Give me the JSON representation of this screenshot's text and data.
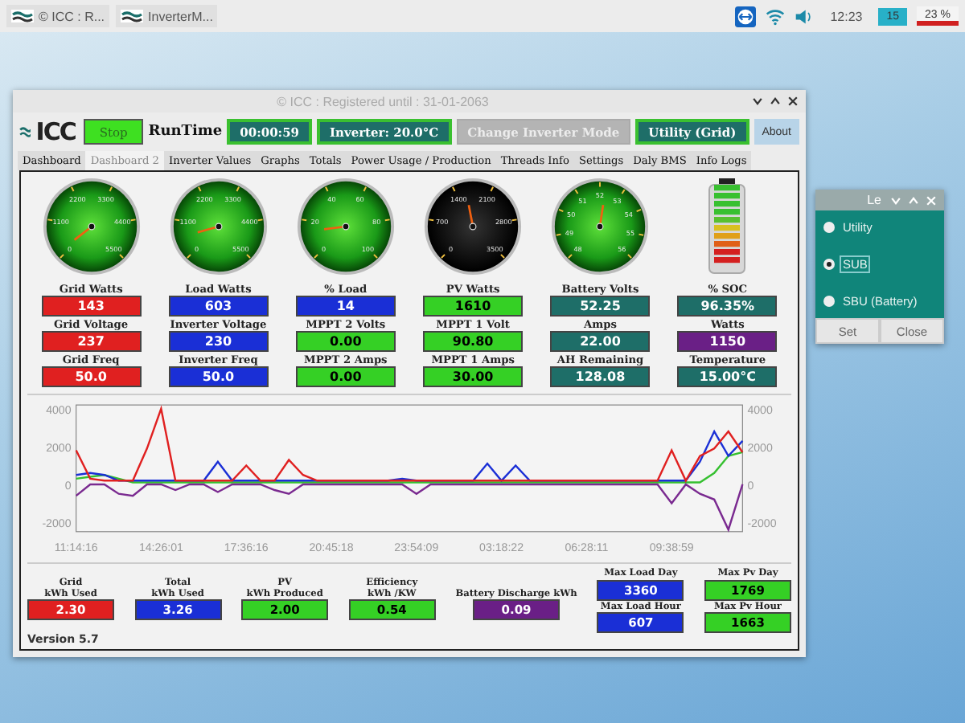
{
  "taskbar": {
    "tasks": [
      {
        "label": "© ICC : R..."
      },
      {
        "label": "InverterM..."
      }
    ],
    "clock": "12:23",
    "cpu_widgets": [
      "15",
      "23 %"
    ]
  },
  "window": {
    "title": "© ICC : Registered until : 31-01-2063",
    "logo": "ICC",
    "toolbar": {
      "stop_button": "Stop",
      "runtime_label": "RunTime",
      "runtime": "00:00:59",
      "inverter_temp": "Inverter: 20.0°C",
      "mode_button": {
        "label": "Change Inverter Mode",
        "disabled": true
      },
      "mode_status": "Utility (Grid)",
      "about_button": "About"
    },
    "tabs": [
      {
        "label": "Dashboard",
        "selected": false
      },
      {
        "label": "Dashboard 2",
        "selected": true
      },
      {
        "label": "Inverter Values",
        "selected": false
      },
      {
        "label": "Graphs",
        "selected": false
      },
      {
        "label": "Totals",
        "selected": false
      },
      {
        "label": "Power Usage / Production",
        "selected": false
      },
      {
        "label": "Threads Info",
        "selected": false
      },
      {
        "label": "Settings",
        "selected": false
      },
      {
        "label": "Daly BMS",
        "selected": false
      },
      {
        "label": "Info Logs",
        "selected": false
      }
    ],
    "columns": [
      {
        "kind": "gauge",
        "gauge": {
          "kind": "green",
          "ticks": [
            "0",
            "1100",
            "2200",
            "3300",
            "4400",
            "5500"
          ]
        },
        "readings": [
          {
            "label": "Grid Watts",
            "value": "143",
            "color": "#e02020"
          },
          {
            "label": "Grid Voltage",
            "value": "237",
            "color": "#e02020"
          },
          {
            "label": "Grid Freq",
            "value": "50.0",
            "color": "#e02020"
          }
        ]
      },
      {
        "kind": "gauge",
        "gauge": {
          "kind": "green",
          "ticks": [
            "0",
            "1100",
            "2200",
            "3300",
            "4400",
            "5500"
          ]
        },
        "readings": [
          {
            "label": "Load Watts",
            "value": "603",
            "color": "#1a2fd6"
          },
          {
            "label": "Inverter Voltage",
            "value": "230",
            "color": "#1a2fd6"
          },
          {
            "label": "Inverter Freq",
            "value": "50.0",
            "color": "#1a2fd6"
          }
        ]
      },
      {
        "kind": "gauge",
        "gauge": {
          "kind": "green",
          "ticks": [
            "0",
            "20",
            "40",
            "60",
            "80",
            "100"
          ]
        },
        "readings": [
          {
            "label": "% Load",
            "value": "14",
            "color": "#1a2fd6"
          },
          {
            "label": "MPPT 2 Volts",
            "value": "0.00",
            "color": "#35d025"
          },
          {
            "label": "MPPT 2 Amps",
            "value": "0.00",
            "color": "#35d025"
          }
        ]
      },
      {
        "kind": "gauge",
        "gauge": {
          "kind": "dark",
          "ticks": [
            "0",
            "700",
            "1400",
            "2100",
            "2800",
            "3500"
          ]
        },
        "readings": [
          {
            "label": "PV Watts",
            "value": "1610",
            "color": "#35d025"
          },
          {
            "label": "MPPT 1 Volt",
            "value": "90.80",
            "color": "#35d025"
          },
          {
            "label": "MPPT 1 Amps",
            "value": "30.00",
            "color": "#35d025"
          }
        ]
      },
      {
        "kind": "gauge",
        "gauge": {
          "kind": "green",
          "ticks": [
            "48",
            "49",
            "50",
            "51",
            "52",
            "53",
            "54",
            "55",
            "56"
          ]
        },
        "readings": [
          {
            "label": "Battery Volts",
            "value": "52.25",
            "color": "#1e6e68"
          },
          {
            "label": "Amps",
            "value": "22.00",
            "color": "#1e6e68"
          },
          {
            "label": "AH Remaining",
            "value": "128.08",
            "color": "#1e6e68"
          }
        ]
      },
      {
        "kind": "battery",
        "battery": {
          "level": 0.96
        },
        "readings": [
          {
            "label": "% SOC",
            "value": "96.35%",
            "color": "#1e6e68"
          },
          {
            "label": "Watts",
            "value": "1150",
            "color": "#6a1f86"
          },
          {
            "label": "Temperature",
            "value": "15.00°C",
            "color": "#1e6e68"
          }
        ]
      }
    ],
    "chart_data": {
      "type": "line",
      "categories": [
        "11:14:16",
        null,
        null,
        null,
        null,
        null,
        "14:26:01",
        null,
        null,
        null,
        null,
        null,
        "17:36:16",
        null,
        null,
        null,
        null,
        null,
        "20:45:18",
        null,
        null,
        null,
        null,
        null,
        "23:54:09",
        null,
        null,
        null,
        null,
        null,
        "03:18:22",
        null,
        null,
        null,
        null,
        null,
        "06:28:11",
        null,
        null,
        null,
        null,
        null,
        "09:38:59",
        null,
        null,
        null,
        null,
        null
      ],
      "ylim": [
        -2500,
        4200
      ],
      "yticks": [
        -2000,
        0,
        2000,
        4000
      ],
      "y2ticks": [
        -2000,
        0,
        2000,
        4000
      ],
      "y2lim": [
        -2500,
        4200
      ],
      "series": [
        {
          "color": "#35c030",
          "values": [
            300,
            400,
            500,
            300,
            100,
            100,
            100,
            100,
            100,
            100,
            100,
            100,
            100,
            100,
            100,
            100,
            100,
            100,
            100,
            100,
            100,
            100,
            100,
            100,
            100,
            100,
            100,
            100,
            100,
            100,
            100,
            100,
            100,
            100,
            100,
            100,
            100,
            100,
            100,
            100,
            100,
            100,
            100,
            100,
            100,
            600,
            1500,
            1700
          ]
        },
        {
          "color": "#1a2fd6",
          "values": [
            500,
            600,
            500,
            200,
            200,
            200,
            200,
            200,
            200,
            200,
            1200,
            200,
            200,
            200,
            200,
            200,
            200,
            200,
            200,
            200,
            200,
            200,
            200,
            300,
            200,
            200,
            200,
            200,
            200,
            1100,
            200,
            1000,
            200,
            200,
            200,
            200,
            200,
            200,
            200,
            200,
            200,
            200,
            200,
            200,
            1200,
            2800,
            1500,
            2300
          ]
        },
        {
          "color": "#7a2a90",
          "values": [
            -600,
            0,
            0,
            -500,
            -600,
            0,
            0,
            -300,
            0,
            0,
            -400,
            0,
            0,
            0,
            -300,
            -500,
            0,
            0,
            0,
            0,
            0,
            0,
            0,
            0,
            -500,
            0,
            0,
            0,
            0,
            0,
            0,
            0,
            0,
            0,
            0,
            0,
            0,
            0,
            0,
            0,
            0,
            0,
            -1000,
            0,
            -500,
            -800,
            -2400,
            0
          ]
        },
        {
          "color": "#e02020",
          "values": [
            1800,
            300,
            200,
            200,
            200,
            1900,
            4000,
            200,
            200,
            200,
            200,
            200,
            1000,
            200,
            200,
            1300,
            500,
            200,
            200,
            200,
            200,
            200,
            200,
            200,
            200,
            200,
            200,
            200,
            200,
            200,
            200,
            200,
            200,
            200,
            200,
            200,
            200,
            200,
            200,
            200,
            200,
            200,
            1800,
            200,
            1500,
            1900,
            2800,
            1700
          ]
        }
      ]
    },
    "stats": [
      {
        "kind": "single",
        "items": [
          {
            "label": "Grid\nkWh Used",
            "value": "2.30",
            "color": "#e02020"
          }
        ]
      },
      {
        "kind": "single",
        "items": [
          {
            "label": "Total\nkWh Used",
            "value": "3.26",
            "color": "#1a2fd6"
          }
        ]
      },
      {
        "kind": "single",
        "items": [
          {
            "label": "PV\nkWh Produced",
            "value": "2.00",
            "color": "#35d025"
          }
        ]
      },
      {
        "kind": "single",
        "items": [
          {
            "label": "Efficiency\nkWh /KW",
            "value": "0.54",
            "color": "#35d025"
          }
        ]
      },
      {
        "kind": "single",
        "items": [
          {
            "label": "Battery Discharge kWh",
            "value": "0.09",
            "color": "#6a1f86"
          }
        ]
      },
      {
        "kind": "stack",
        "items": [
          {
            "label": "Max Load Day",
            "value": "3360",
            "color": "#1a2fd6"
          },
          {
            "label": "Max Load Hour",
            "value": "607",
            "color": "#1a2fd6"
          }
        ]
      },
      {
        "kind": "stack",
        "items": [
          {
            "label": "Max Pv Day",
            "value": "1769",
            "color": "#35d025"
          },
          {
            "label": "Max Pv Hour",
            "value": "1663",
            "color": "#35d025"
          }
        ]
      }
    ],
    "version": "Version 5.7"
  },
  "dialog": {
    "title": "Le",
    "options": [
      {
        "label": "Utility",
        "selected": false
      },
      {
        "label": "SUB",
        "selected": true
      },
      {
        "label": "SBU (Battery)",
        "selected": false
      }
    ],
    "buttons": [
      "Set",
      "Close"
    ]
  }
}
